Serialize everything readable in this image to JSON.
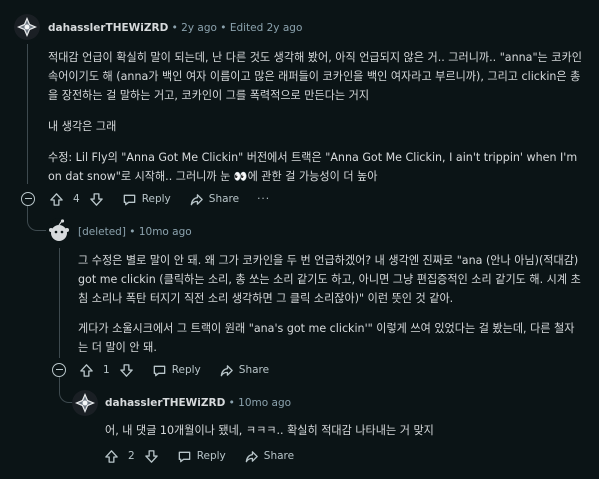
{
  "comments": [
    {
      "author": "dahasslerTHEWiZRD",
      "time": "2y ago",
      "edited": "Edited 2y ago",
      "paragraphs": [
        "적대감 언급이 확실히 말이 되는데, 난 다른 것도 생각해 봤어, 아직 언급되지 않은 거.. 그러니까.. \"anna\"는 코카인 속어이기도 해 (anna가 백인 여자 이름이고 많은 래퍼들이 코카인을 백인 여자라고 부르니까), 그리고 clickin은 총을 장전하는 걸 말하는 거고, 코카인이 그를 폭력적으로 만든다는 거지",
        "내 생각은 그래"
      ],
      "edit_note_before": "수정: Lil Fly의 \"Anna Got Me Clickin\" 버전에서 트랙은 \"Anna Got Me Clickin, I ain't trippin' when I'm on dat snow\"로 시작해.. 그러니까 눈 ",
      "edit_note_emoji": "👀",
      "edit_note_after": "에 관한 걸 가능성이 더 높아",
      "score": "4",
      "reply_label": "Reply",
      "share_label": "Share",
      "more_label": "···"
    },
    {
      "author": "[deleted]",
      "time": "10mo ago",
      "paragraphs": [
        "그 수정은 별로 말이 안 돼. 왜 그가 코카인을 두 번 언급하겠어? 내 생각엔 진짜로 \"ana (안나 아님)(적대감) got me clickin (클릭하는 소리, 총 쏘는 소리 같기도 하고, 아니면 그냥 편집증적인 소리 같기도 해. 시계 초침 소리나 폭탄 터지기 직전 소리 생각하면 그 클릭 소리잖아)\" 이런 뜻인 것 같아.",
        "게다가 소울시크에서 그 트랙이 원래 \"ana's got me clickin'\" 이렇게 쓰여 있었다는 걸 봤는데, 다른 철자는 더 말이 안 돼."
      ],
      "score": "1",
      "reply_label": "Reply",
      "share_label": "Share"
    },
    {
      "author": "dahasslerTHEWiZRD",
      "time": "10mo ago",
      "paragraphs": [
        "어, 내 댓글 10개월이나 됐네, ㅋㅋㅋ.. 확실히 적대감 나타내는 거 맞지"
      ],
      "score": "2",
      "reply_label": "Reply",
      "share_label": "Share"
    }
  ],
  "separator": "•",
  "colors": {
    "background": "#0b1416",
    "text": "#d7dadc",
    "meta": "#8ba2ad",
    "thread_line": "#3e4a4f",
    "action": "#b8c5c9"
  }
}
